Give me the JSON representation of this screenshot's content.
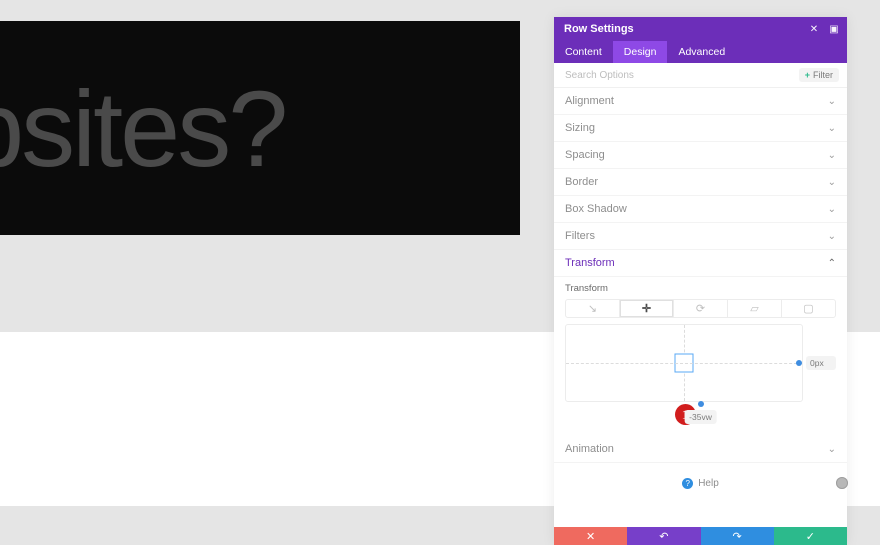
{
  "canvas": {
    "hero_text": "/ebsites?"
  },
  "panel": {
    "title": "Row Settings",
    "tabs": {
      "content": "Content",
      "design": "Design",
      "advanced": "Advanced"
    },
    "search_placeholder": "Search Options",
    "filter": {
      "icon": "+",
      "label": "Filter"
    },
    "sections": {
      "alignment": "Alignment",
      "sizing": "Sizing",
      "spacing": "Spacing",
      "border": "Border",
      "box_shadow": "Box Shadow",
      "filters": "Filters",
      "transform": "Transform",
      "animation": "Animation"
    },
    "transform": {
      "sub_label": "Transform",
      "right_value": "0px",
      "bottom_value": "-35vw"
    },
    "annotation": {
      "badge": "1"
    },
    "help": "Help",
    "footer": {
      "clear": "✕",
      "undo": "↶",
      "redo": "↷",
      "save": "✓"
    }
  }
}
